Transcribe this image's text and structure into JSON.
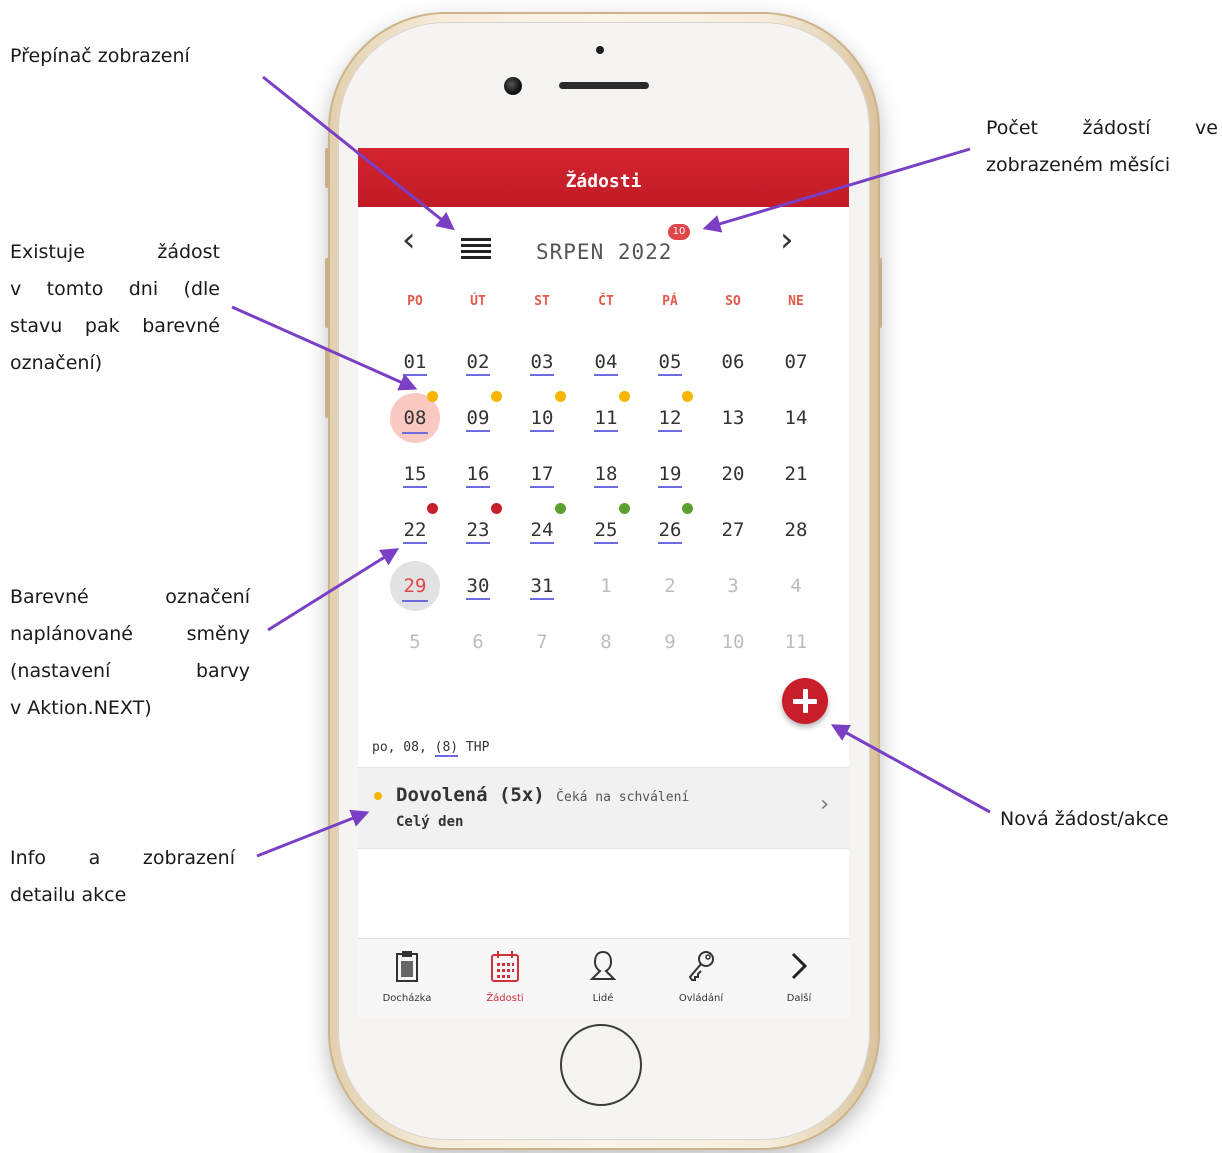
{
  "annotations": {
    "view_switch": [
      "Přepínač zobrazení"
    ],
    "request_count": [
      "Počet žádostí ve",
      "zobrazeném měsíci"
    ],
    "request_exists": [
      "Existuje žádost",
      "v tomto dni (dle",
      "stavu pak barevné",
      "označení)"
    ],
    "shift_color": [
      "Barevné označení",
      "naplánované směny",
      "(nastavení barvy",
      "v Aktion.NEXT)"
    ],
    "info_detail": [
      "Info a zobrazení",
      "detailu akce"
    ],
    "new_request": [
      "Nová žádost/akce"
    ]
  },
  "header": {
    "title": "Žádosti"
  },
  "calendar": {
    "month_label": "SRPEN 2022",
    "badge_count": "10",
    "weekdays": [
      "PO",
      "ÚT",
      "ST",
      "ČT",
      "PÁ",
      "SO",
      "NE"
    ],
    "weeks": [
      [
        "01",
        "02",
        "03",
        "04",
        "05",
        "06",
        "07"
      ],
      [
        "08",
        "09",
        "10",
        "11",
        "12",
        "13",
        "14"
      ],
      [
        "15",
        "16",
        "17",
        "18",
        "19",
        "20",
        "21"
      ],
      [
        "22",
        "23",
        "24",
        "25",
        "26",
        "27",
        "28"
      ],
      [
        "29",
        "30",
        "31",
        "1",
        "2",
        "3",
        "4"
      ],
      [
        "5",
        "6",
        "7",
        "8",
        "9",
        "10",
        "11"
      ]
    ],
    "colors": {
      "pending": "#f7b500",
      "rejected": "#c81e2b",
      "approved": "#5aa02c",
      "request_underline": "#6e6be0",
      "selected_bg": "#f9c9c2",
      "today_bg": "#e2e2e2"
    }
  },
  "selected_day": {
    "prefix": "po, 08, ",
    "shift": "(8)",
    "group": " THP"
  },
  "event": {
    "title": "Dovolená (5x)",
    "status": "Čeká na schválení",
    "subtitle": "Celý den",
    "chevron": "›"
  },
  "tabbar": {
    "tabs": [
      {
        "label": "Docházka",
        "icon": "clipboard-icon"
      },
      {
        "label": "Žádosti",
        "icon": "calendar-icon",
        "active": true
      },
      {
        "label": "Lidé",
        "icon": "person-icon"
      },
      {
        "label": "Ovládání",
        "icon": "key-icon"
      },
      {
        "label": "Další",
        "icon": "chevron-right-icon"
      }
    ]
  }
}
